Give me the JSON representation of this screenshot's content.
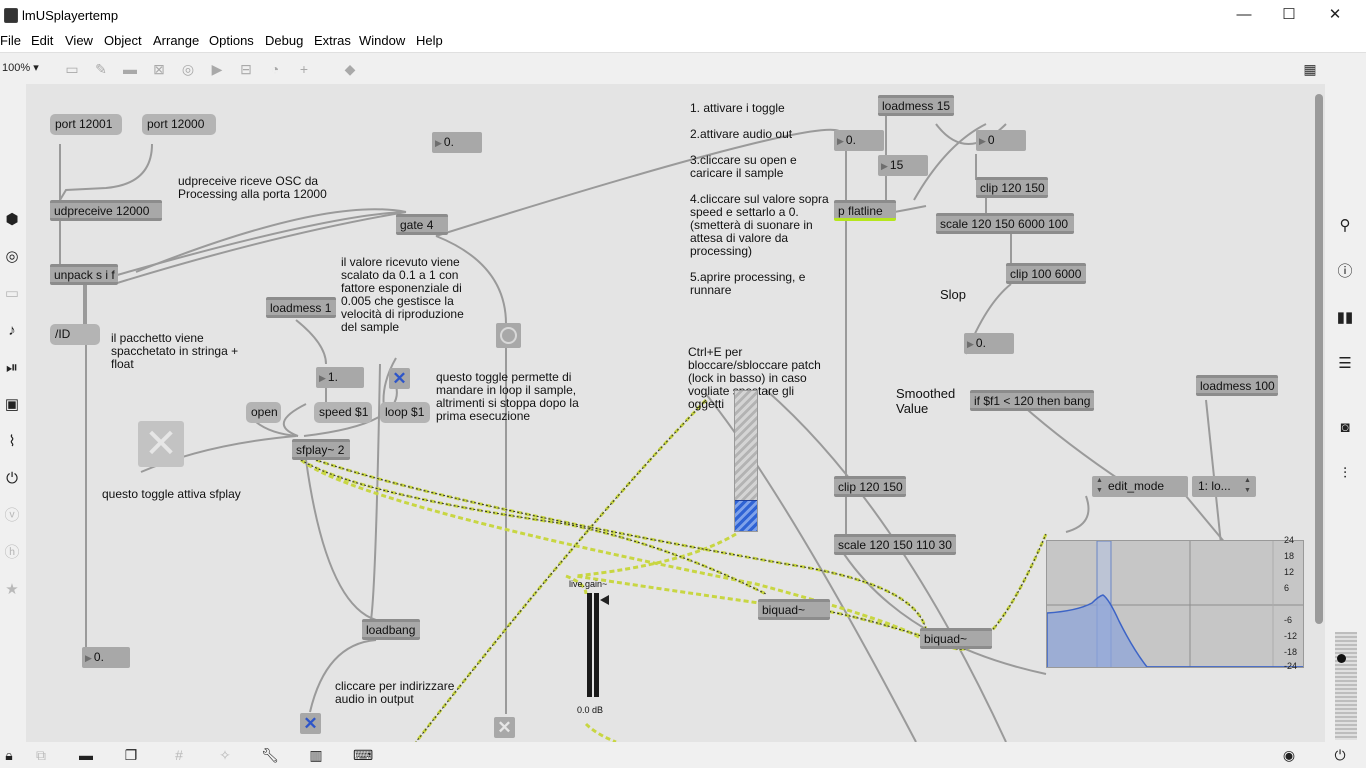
{
  "window": {
    "title": "lmUSplayertemp",
    "min": "—",
    "max": "☐",
    "close": "✕"
  },
  "menu": [
    "File",
    "Edit",
    "View",
    "Object",
    "Arrange",
    "Options",
    "Debug",
    "Extras",
    "Window",
    "Help"
  ],
  "toolbar": {
    "zoom": "100%",
    "zoom_caret": "▾"
  },
  "objects": {
    "udpreceive": "udpreceive 12000",
    "unpack": "unpack s i f",
    "gate": "gate 4",
    "loadmess1": "loadmess 1",
    "sfplay": "sfplay~ 2",
    "loadbang": "loadbang",
    "loadmess15": "loadmess 15",
    "p_flatline": "p flatline",
    "clip_top": "clip 120 150",
    "scale_top": "scale 120 150 6000 100",
    "clip_100": "clip 100 6000",
    "if_obj": "if $f1 < 120 then bang",
    "loadmess100": "loadmess 100",
    "clip_mid": "clip 120 150",
    "scale_mid": "scale 120 150 110 30",
    "biquad1": "biquad~",
    "biquad2": "biquad~"
  },
  "messages": {
    "port1": "port 12001",
    "port2": "port 12000",
    "id": "/ID",
    "open": "open",
    "speed": "speed $1",
    "loop": "loop $1"
  },
  "numbers": {
    "n_top": "0.",
    "n_one": "1.",
    "n_bottom": "0.",
    "n_gate": "0.",
    "n_15": "15",
    "n_0": "0",
    "n_slop": "0."
  },
  "comments": {
    "udp": "udpreceive riceve OSC da Processing alla porta 12000",
    "unpack": "il pacchetto viene spacchetato in stringa + float",
    "scaled": "il valore ricevuto viene scalato da 0.1 a 1 con fattore esponenziale di 0.005 che gestisce la velocità di riproduzione del sample",
    "loop": "questo toggle permette di mandare in loop il sample, altrimenti si stoppa dopo la prima esecuzione",
    "sfplay_toggle": "questo toggle attiva sfplay",
    "output": "cliccare per indirizzare audio in output",
    "steps": "1. attivare i toggle\n\n2.attivare audio out\n\n3.cliccare su open e caricare il sample\n\n4.cliccare sul valore sopra speed e settarlo a 0. (smetterà di suonare in attesa di valore da processing)\n\n5.aprire processing, e runnare",
    "ctrl": "Ctrl+E per bloccare/sbloccare patch (lock in basso) in caso vogliate spostare gli oggetti",
    "slop": "Slop",
    "smoothed": "Smoothed Value"
  },
  "livegain": {
    "label": "live.gain~",
    "value": "0.0 dB"
  },
  "umenus": {
    "edit_mode": "edit_mode",
    "mode": "1: lo..."
  },
  "filter_db_ticks": [
    "24",
    "18",
    "12",
    "6",
    "-6",
    "-12",
    "-18",
    "-24"
  ],
  "colors": {
    "canvas": "#e4e4e4",
    "signal_wire": "#c8d642",
    "accent_blue": "#2f63d4",
    "flatline_bar": "#b5e61d"
  },
  "icons": {
    "left": [
      "cube-icon",
      "target-icon",
      "package-icon",
      "music-note-icon",
      "play-step-icon",
      "image-icon",
      "paperclip-icon",
      "plug-icon",
      "v-icon",
      "h-icon",
      "star-icon"
    ],
    "right": [
      "search-icon",
      "info-icon",
      "book-icon",
      "list-icon",
      "camera-icon",
      "sliders-icon"
    ],
    "bottom": [
      "lock-icon",
      "new-object-icon",
      "presentation-icon",
      "windows-icon",
      "grid-icon",
      "wand-icon",
      "wrench-icon",
      "piano-icon",
      "keyboard-icon"
    ]
  }
}
